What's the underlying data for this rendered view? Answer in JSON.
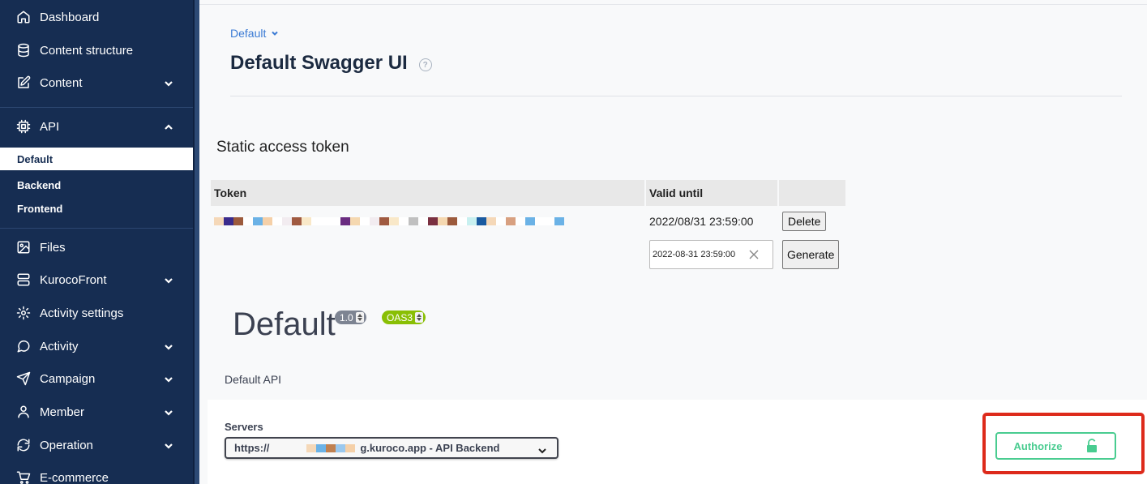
{
  "sidebar": {
    "items_top": [
      {
        "label": "Dashboard",
        "icon": "home-icon"
      },
      {
        "label": "Content structure",
        "icon": "database-icon"
      },
      {
        "label": "Content",
        "icon": "edit-icon"
      }
    ],
    "api": {
      "label": "API",
      "icon": "chip-icon"
    },
    "api_sub": [
      "Default",
      "Backend",
      "Frontend"
    ],
    "items_bottom": [
      {
        "label": "Files",
        "icon": "image-icon"
      },
      {
        "label": "KurocoFront",
        "icon": "server-icon"
      },
      {
        "label": "Activity settings",
        "icon": "gear-icon"
      },
      {
        "label": "Activity",
        "icon": "chat-icon"
      },
      {
        "label": "Campaign",
        "icon": "send-icon"
      },
      {
        "label": "Member",
        "icon": "user-icon"
      },
      {
        "label": "Operation",
        "icon": "refresh-icon"
      },
      {
        "label": "E-commerce",
        "icon": "cart-icon"
      }
    ]
  },
  "main": {
    "breadcrumb": "Default",
    "title": "Default Swagger UI",
    "help_glyph": "?",
    "static_token": {
      "heading": "Static access token",
      "headers": {
        "token": "Token",
        "valid_until": "Valid until"
      },
      "row": {
        "valid_until": "2022/08/31 23:59:00",
        "delete_label": "Delete"
      },
      "date_input_value": "2022-08-31 23:59:00",
      "generate_label": "Generate"
    },
    "swagger": {
      "title": "Default",
      "version": "1.0",
      "oas": "OAS3",
      "description": "Default API",
      "servers_label": "Servers",
      "server_prefix": "https://",
      "server_suffix": "g.kuroco.app - API Backend",
      "authorize_label": "Authorize"
    }
  },
  "colors": {
    "sidebar_bg": "#162d52",
    "link": "#3b7bd4",
    "authorize": "#49cc90",
    "highlight": "#dd2a1b",
    "version_badge": "#7d8492",
    "oas_badge": "#89bf04"
  }
}
